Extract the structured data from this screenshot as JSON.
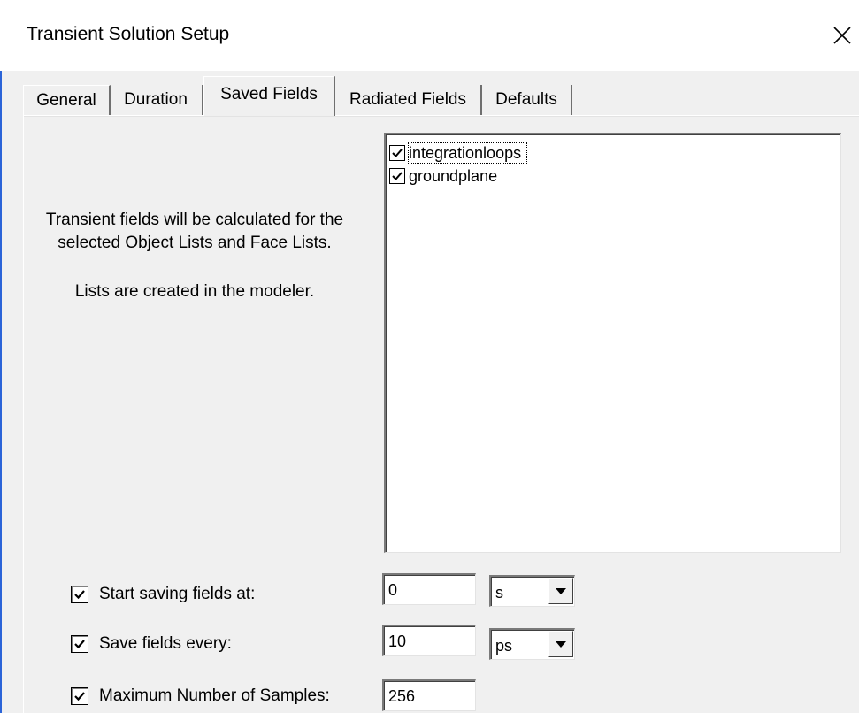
{
  "window": {
    "title": "Transient Solution Setup",
    "close_icon": "close-icon"
  },
  "tabs": [
    {
      "label": "General",
      "active": false
    },
    {
      "label": "Duration",
      "active": false
    },
    {
      "label": "Saved Fields",
      "active": true
    },
    {
      "label": "Radiated Fields",
      "active": false
    },
    {
      "label": "Defaults",
      "active": false
    }
  ],
  "info": {
    "line1": "Transient fields will be calculated for the",
    "line2": "selected Object Lists and Face Lists.",
    "line3": "Lists are created in the modeler."
  },
  "lists": [
    {
      "label": "integrationloops",
      "checked": true
    },
    {
      "label": "groundplane",
      "checked": true
    }
  ],
  "settings": {
    "start": {
      "label": "Start saving fields at:",
      "checked": true,
      "value": "0",
      "unit": "s"
    },
    "every": {
      "label": "Save fields every:",
      "checked": true,
      "value": "10",
      "unit": "ps"
    },
    "max": {
      "label": "Maximum Number of Samples:",
      "checked": true,
      "value": "256"
    }
  }
}
